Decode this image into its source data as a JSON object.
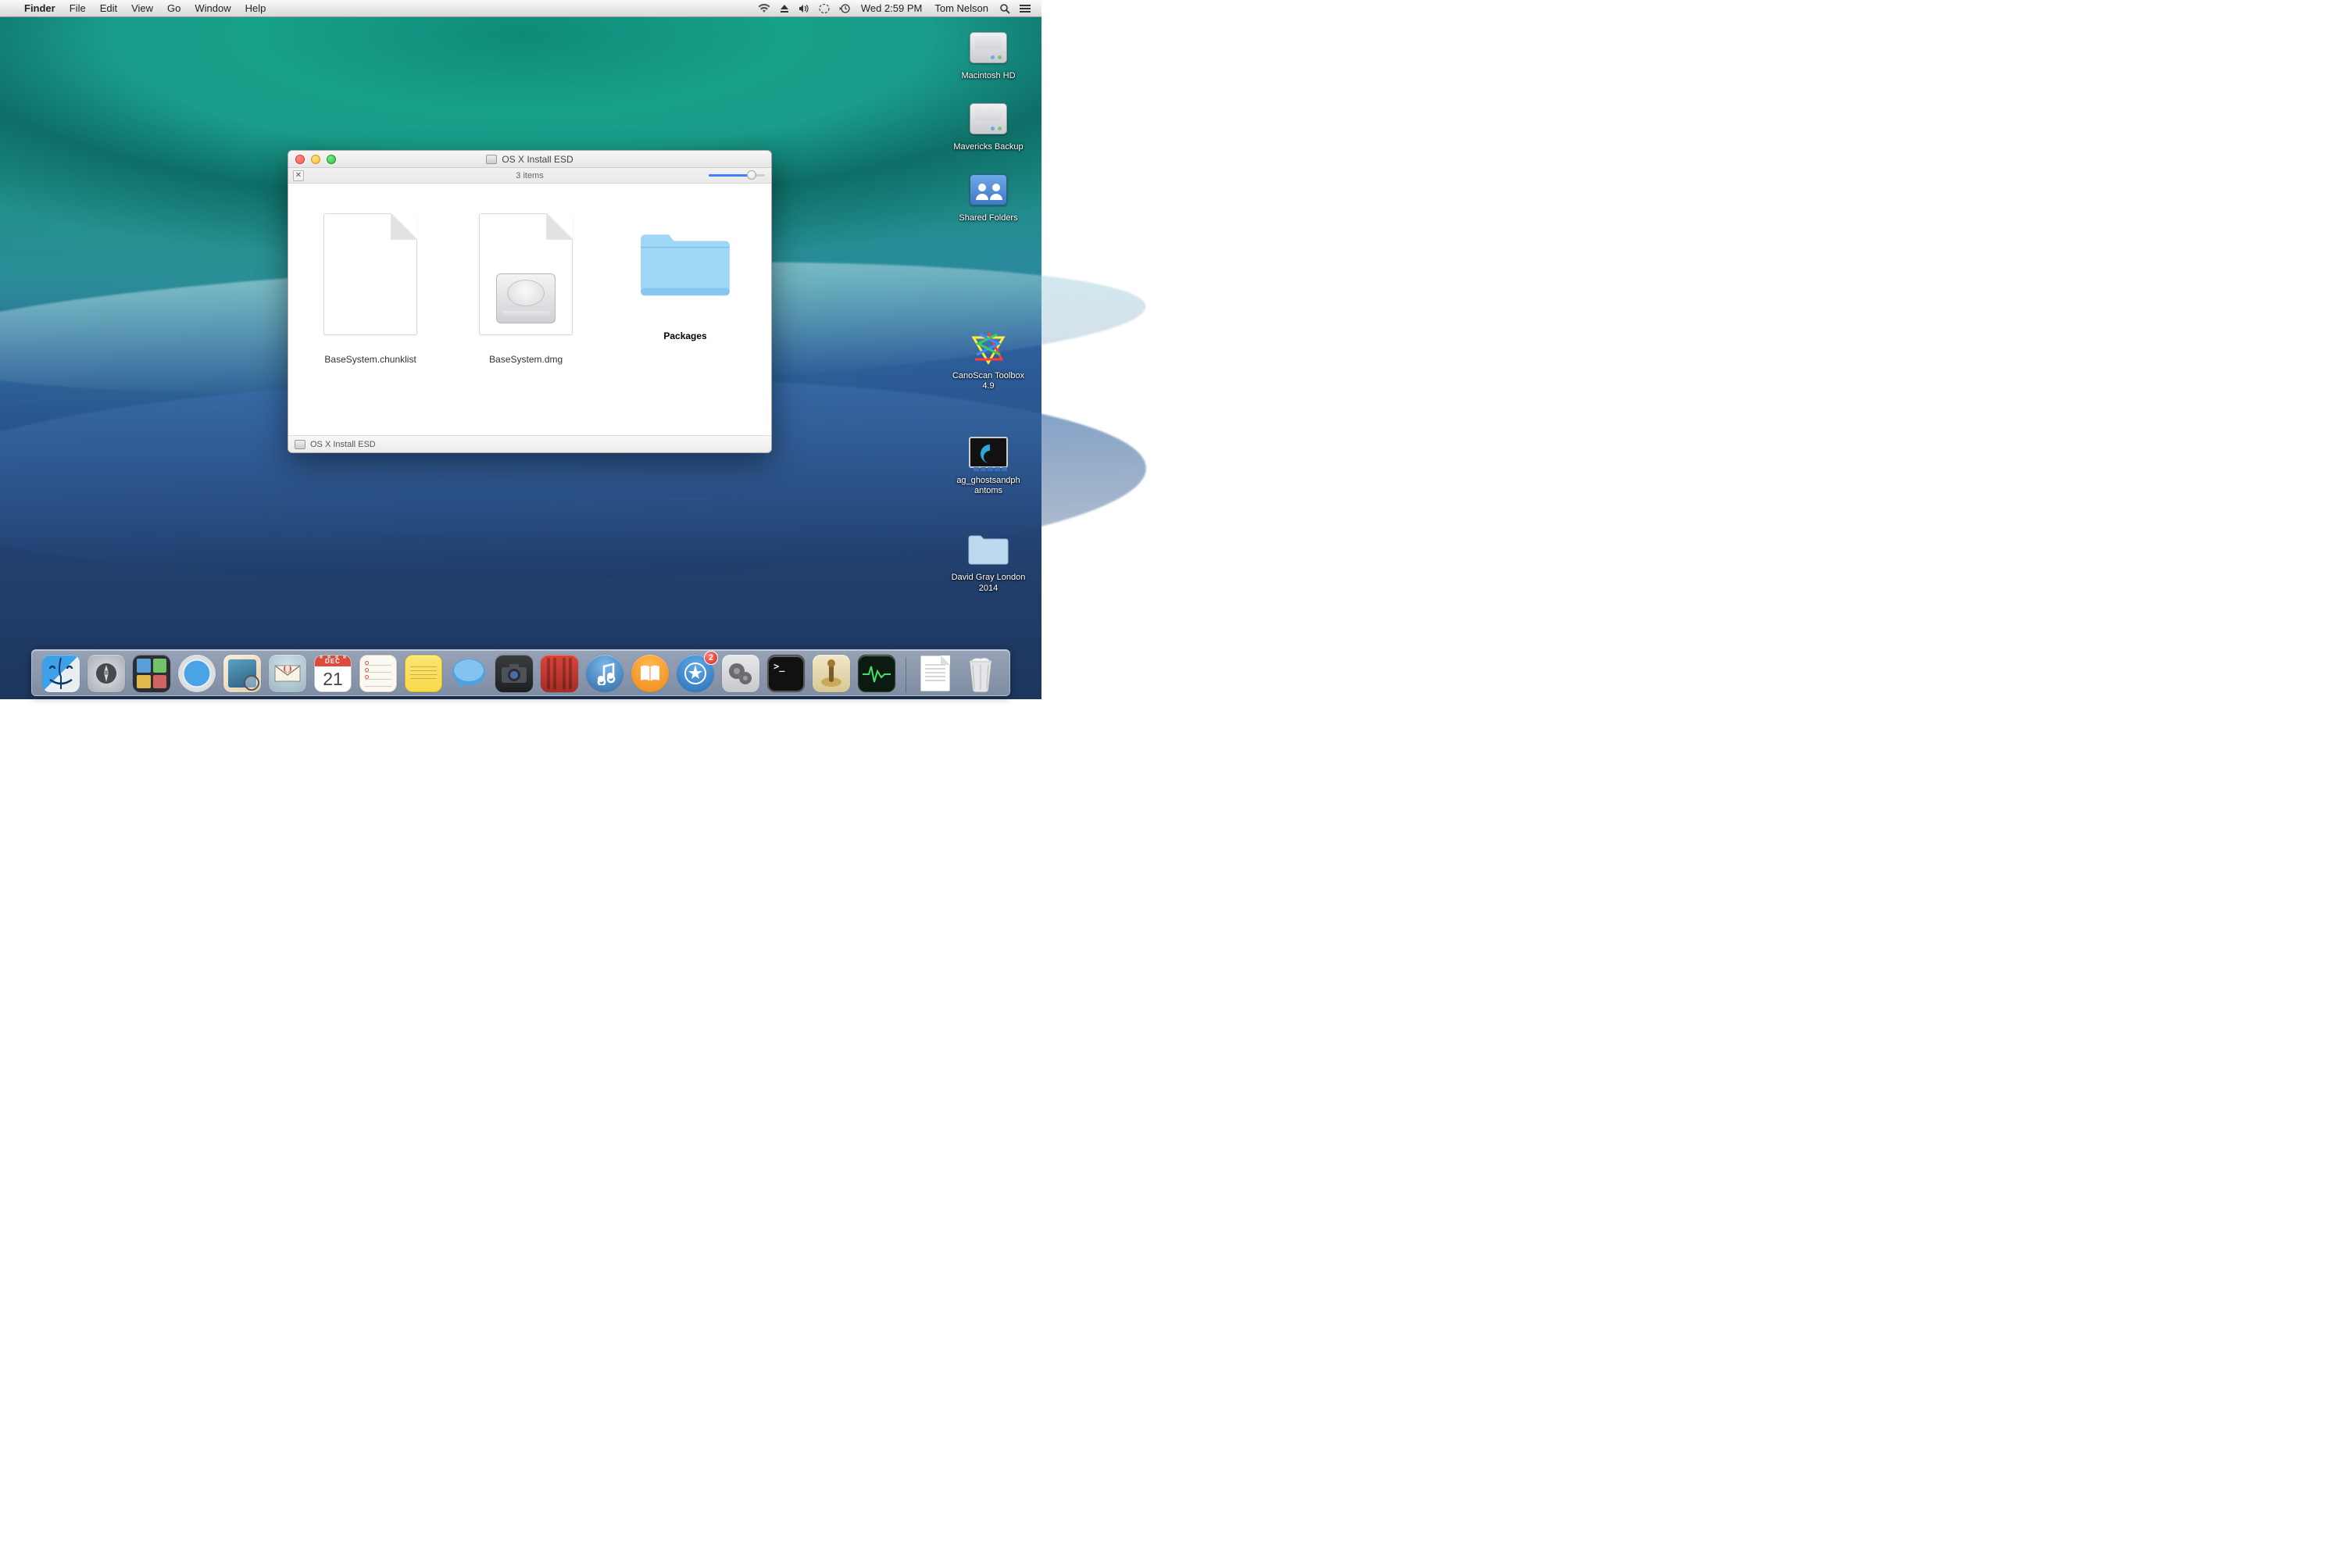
{
  "menubar": {
    "app": "Finder",
    "items": [
      "File",
      "Edit",
      "View",
      "Go",
      "Window",
      "Help"
    ],
    "clock": "Wed 2:59 PM",
    "username": "Tom Nelson"
  },
  "desktop": {
    "items": [
      {
        "label": "Macintosh HD"
      },
      {
        "label": "Mavericks Backup"
      },
      {
        "label": "Shared Folders"
      },
      {
        "label": "CanoScan Toolbox 4.9"
      },
      {
        "label": "ag_ghostsandph antoms"
      },
      {
        "label": "David Gray London 2014"
      }
    ]
  },
  "window": {
    "title": "OS X Install ESD",
    "item_count": "3 items",
    "files": [
      {
        "label": "BaseSystem.chunklist",
        "kind": "blank"
      },
      {
        "label": "BaseSystem.dmg",
        "kind": "dmg"
      },
      {
        "label": "Packages",
        "kind": "folder",
        "selected": true
      }
    ],
    "path": "OS X Install ESD"
  },
  "dock": {
    "calendar_month": "DEC",
    "calendar_day": "21",
    "badge": "2",
    "items": [
      "finder",
      "launchpad",
      "mission-control",
      "safari",
      "preview",
      "mail",
      "calendar",
      "reminders",
      "notes",
      "messages",
      "photo-booth",
      "screen-flow",
      "itunes",
      "ibooks",
      "app-store",
      "system-preferences",
      "terminal",
      "handbrake",
      "activity-monitor"
    ],
    "right_items": [
      "document",
      "trash"
    ]
  }
}
